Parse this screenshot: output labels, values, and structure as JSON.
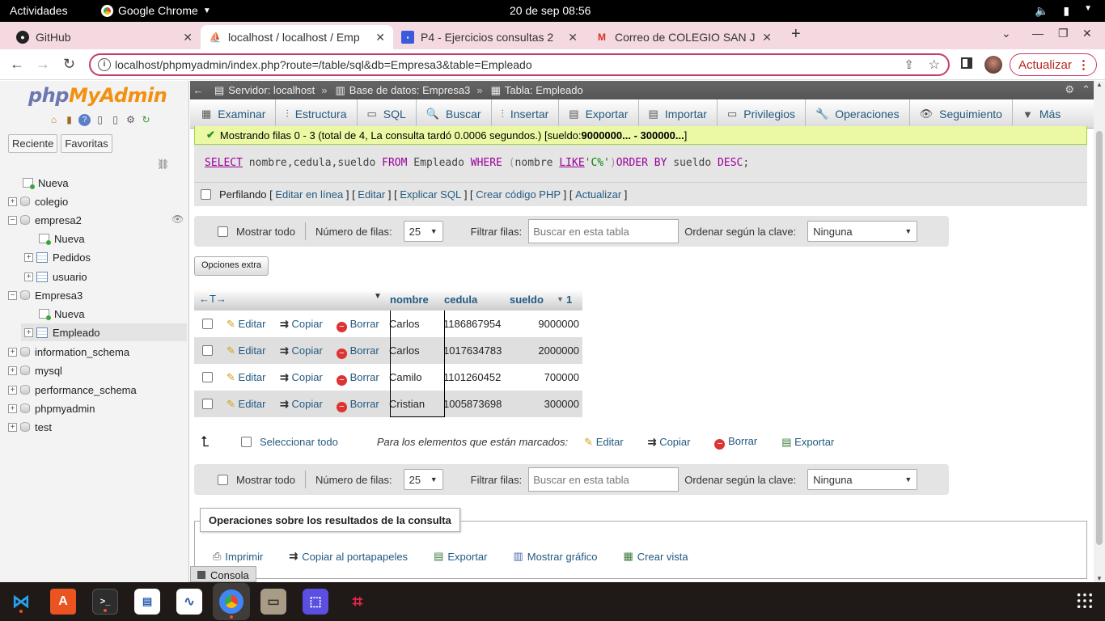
{
  "system": {
    "activities": "Actividades",
    "app_name": "Google Chrome",
    "clock": "20 de sep  08:56"
  },
  "browser": {
    "tabs": [
      {
        "label": "GitHub",
        "icon": "github-icon"
      },
      {
        "label": "localhost / localhost / Emp",
        "icon": "phpmyadmin-icon"
      },
      {
        "label": "P4 - Ejercicios consultas 2",
        "icon": "slides-icon"
      },
      {
        "label": "Correo de COLEGIO SAN J",
        "icon": "gmail-icon"
      }
    ],
    "url": "localhost/phpmyadmin/index.php?route=/table/sql&db=Empresa3&table=Empleado",
    "update_label": "Actualizar"
  },
  "nav": {
    "logo_php": "php",
    "logo_my": "MyAdmin",
    "tab_recent": "Reciente",
    "tab_favorites": "Favoritas",
    "tree": [
      {
        "label": "Nueva",
        "kind": "new",
        "level": 0
      },
      {
        "label": "colegio",
        "kind": "db",
        "level": 0
      },
      {
        "label": "empresa2",
        "kind": "db",
        "level": 0,
        "expanded": true
      },
      {
        "label": "Nueva",
        "kind": "new",
        "level": 1
      },
      {
        "label": "Pedidos",
        "kind": "table",
        "level": 1
      },
      {
        "label": "usuario",
        "kind": "table",
        "level": 1
      },
      {
        "label": "Empresa3",
        "kind": "db",
        "level": 0,
        "expanded": true
      },
      {
        "label": "Nueva",
        "kind": "new",
        "level": 1
      },
      {
        "label": "Empleado",
        "kind": "table",
        "level": 1,
        "selected": true
      },
      {
        "label": "information_schema",
        "kind": "db",
        "level": 0
      },
      {
        "label": "mysql",
        "kind": "db",
        "level": 0
      },
      {
        "label": "performance_schema",
        "kind": "db",
        "level": 0
      },
      {
        "label": "phpmyadmin",
        "kind": "db",
        "level": 0
      },
      {
        "label": "test",
        "kind": "db",
        "level": 0
      }
    ]
  },
  "breadcrumb": {
    "server": "Servidor: localhost",
    "database": "Base de datos: Empresa3",
    "table": "Tabla: Empleado"
  },
  "menu": [
    {
      "label": "Examinar",
      "icon": "browse-icon"
    },
    {
      "label": "Estructura",
      "icon": "structure-icon"
    },
    {
      "label": "SQL",
      "icon": "sql-icon"
    },
    {
      "label": "Buscar",
      "icon": "search-icon"
    },
    {
      "label": "Insertar",
      "icon": "insert-icon"
    },
    {
      "label": "Exportar",
      "icon": "export-icon"
    },
    {
      "label": "Importar",
      "icon": "import-icon"
    },
    {
      "label": "Privilegios",
      "icon": "privileges-icon"
    },
    {
      "label": "Operaciones",
      "icon": "operations-icon"
    },
    {
      "label": "Seguimiento",
      "icon": "tracking-icon"
    },
    {
      "label": "Más",
      "icon": "chevron-down-icon"
    }
  ],
  "result": {
    "message_prefix": "Mostrando filas 0 -  3 (total de 4, La consulta tardó 0.0006 segundos.) [sueldo: ",
    "message_bold": "9000000... - 300000...",
    "message_suffix": "]",
    "sql": {
      "select": "SELECT",
      "fields": " nombre,cedula,sueldo ",
      "from": "FROM",
      "table": " Empleado ",
      "where": "WHERE",
      "open": " (",
      "col": "nombre ",
      "like": "LIKE",
      "literal": "'C%'",
      "close": ")",
      "order": "ORDER BY",
      "ordcol": " sueldo ",
      "desc": "DESC",
      "end": ";"
    },
    "profiling_label": "Perfilando",
    "sql_links": [
      "Editar en línea",
      "Editar",
      "Explicar SQL",
      "Crear código PHP",
      "Actualizar"
    ]
  },
  "navpanel": {
    "show_all": "Mostrar todo",
    "rows_label": "Número de filas:",
    "rows_value": "25",
    "filter_label": "Filtrar filas:",
    "filter_placeholder": "Buscar en esta tabla",
    "sort_label": "Ordenar según la clave:",
    "sort_value": "Ninguna"
  },
  "extra_options": "Opciones extra",
  "table": {
    "columns": [
      "nombre",
      "cedula",
      "sueldo"
    ],
    "sort_index": "1",
    "row_actions": {
      "edit": "Editar",
      "copy": "Copiar",
      "delete": "Borrar"
    },
    "rows": [
      {
        "nombre": "Carlos",
        "cedula": "1186867954",
        "sueldo": "9000000"
      },
      {
        "nombre": "Carlos",
        "cedula": "1017634783",
        "sueldo": "2000000"
      },
      {
        "nombre": "Camilo",
        "cedula": "1101260452",
        "sueldo": "700000"
      },
      {
        "nombre": "Cristian",
        "cedula": "1005873698",
        "sueldo": "300000"
      }
    ]
  },
  "bulk": {
    "select_all": "Seleccionar todo",
    "marked_label": "Para los elementos que están marcados:",
    "edit": "Editar",
    "copy": "Copiar",
    "delete": "Borrar",
    "export": "Exportar"
  },
  "query_ops": {
    "title": "Operaciones sobre los resultados de la consulta",
    "print": "Imprimir",
    "copy_clipboard": "Copiar al portapapeles",
    "export": "Exportar",
    "chart": "Mostrar gráfico",
    "create_view": "Crear vista"
  },
  "console_label": "Consola"
}
